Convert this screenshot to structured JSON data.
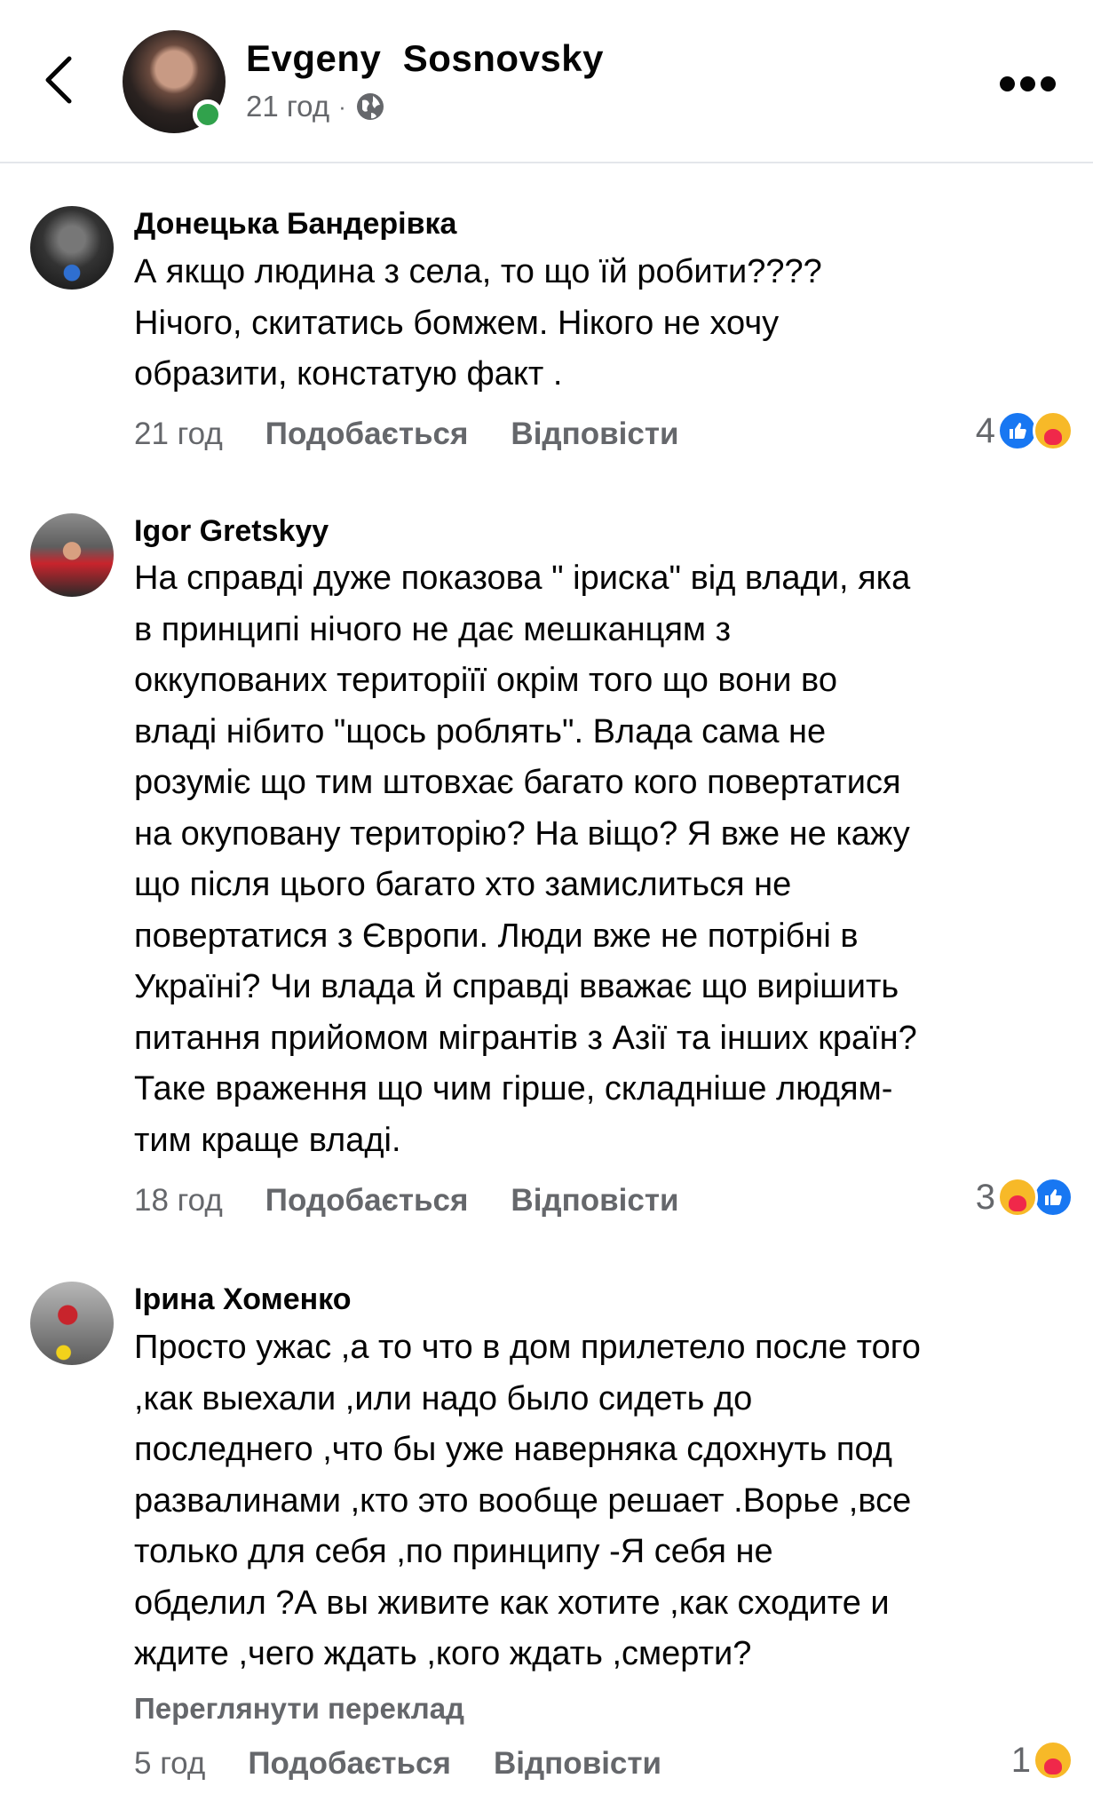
{
  "post_header": {
    "author": "Evgeny  Sosnovsky",
    "time": "21 год",
    "separator": "·",
    "privacy_icon": "globe-icon"
  },
  "comments": [
    {
      "author": "Донецька Бандерівка",
      "lines": [
        "А якщо людина з села, то що їй робити????",
        "Нічого, скитатись бомжем. Нікого не хочу",
        "образити, констатую факт ."
      ],
      "time": "21 год",
      "like_label": "Подобається",
      "reply_label": "Відповісти",
      "reaction_count": "4",
      "reactions": [
        "like-icon",
        "care-icon"
      ]
    },
    {
      "author": "Igor Gretskyy",
      "lines": [
        "На справді дуже показова \" іриска\" від влади, яка",
        "в принципі нічого не дає мешканцям з",
        "оккупованих територіїї окрім того  що вони во",
        "владі нібито \"щось роблять\". Влада сама не",
        "розуміє що тим штовхає багато кого повертатися",
        "на окуповану територію? На віщо? Я вже не кажу",
        "що після цього багато хто замислиться  не",
        "повертатися з Європи. Люди вже не потрібні в",
        "Україні? Чи влада й справді вважає що вирішить",
        "питання прийомом мігрантів з Азії та інших країн?",
        "Таке враження що чим гірше, складніше людям-",
        "тим краще владі."
      ],
      "time": "18 год",
      "like_label": "Подобається",
      "reply_label": "Відповісти",
      "reaction_count": "3",
      "reactions": [
        "care-icon",
        "like-icon"
      ]
    },
    {
      "author": "Ірина Хоменко",
      "lines": [
        "Просто ужас ,а то что в дом прилетело после того",
        ",как выехали ,или надо было сидеть до",
        "последнего ,что бы уже наверняка сдохнуть под",
        "развалинами ,кто это вообще решает .Ворье ,все",
        "только для себя ,по принципу -Я себя не",
        "обделил ?А вы живите как хотите ,как сходите и",
        "ждите ,чего ждать ,кого ждать ,смерти?"
      ],
      "translate_label": "Переглянути переклад",
      "time": "5 год",
      "like_label": "Подобається",
      "reply_label": "Відповісти",
      "reaction_count": "1",
      "reactions": [
        "care-icon"
      ]
    }
  ]
}
